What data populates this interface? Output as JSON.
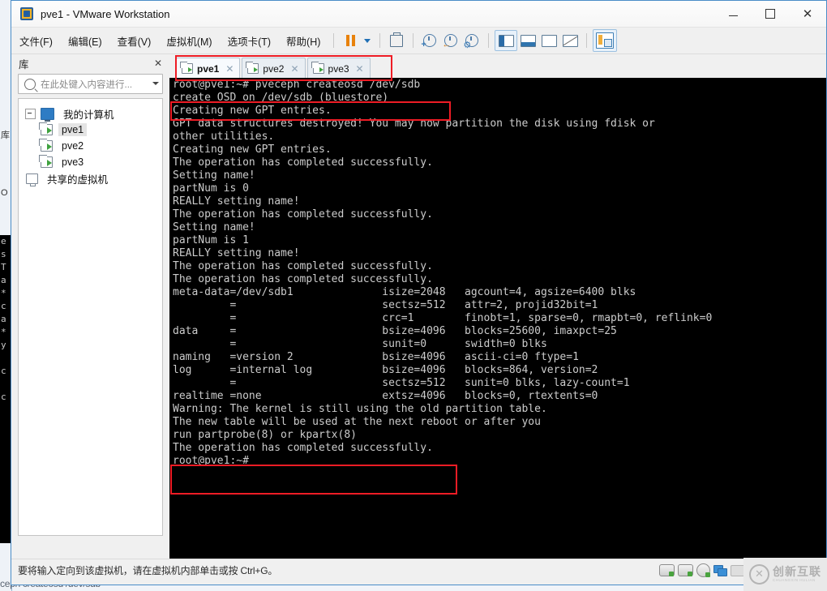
{
  "window": {
    "title": "pve1 - VMware Workstation",
    "app_icon": "vmware-icon",
    "controls": {
      "minimize": "—",
      "maximize": "□",
      "close": "✕"
    }
  },
  "menubar": {
    "items": [
      {
        "label": "文件(F)",
        "name": "menu-file"
      },
      {
        "label": "编辑(E)",
        "name": "menu-edit"
      },
      {
        "label": "查看(V)",
        "name": "menu-view"
      },
      {
        "label": "虚拟机(M)",
        "name": "menu-vm"
      },
      {
        "label": "选项卡(T)",
        "name": "menu-tabs"
      },
      {
        "label": "帮助(H)",
        "name": "menu-help"
      }
    ]
  },
  "toolbar": {
    "icons": [
      "pause-icon",
      "power-dropdown-caret-icon",
      "snapshot-icon",
      "take-snapshot-icon",
      "revert-snapshot-icon",
      "snapshot-manager-icon",
      "show-library-icon",
      "show-thumbnail-bar-icon",
      "enter-fullscreen-icon",
      "unity-mode-icon",
      "show-console-panel-icon"
    ],
    "snapshot_badge_add": "+",
    "snapshot_badge_revert": "←",
    "snapshot_badge_manage": "⚙"
  },
  "sidebar": {
    "title": "库",
    "close_label": "✕",
    "search": {
      "placeholder": "在此处键入内容进行...",
      "value": ""
    },
    "tree": [
      {
        "label": "我的计算机",
        "level": 0,
        "icon": "my-computer-icon",
        "selected": false,
        "name": "tree-item-my-computer"
      },
      {
        "label": "pve1",
        "level": 1,
        "icon": "vm-icon",
        "selected": true,
        "name": "tree-item-pve1"
      },
      {
        "label": "pve2",
        "level": 1,
        "icon": "vm-icon",
        "selected": false,
        "name": "tree-item-pve2"
      },
      {
        "label": "pve3",
        "level": 1,
        "icon": "vm-icon",
        "selected": false,
        "name": "tree-item-pve3"
      },
      {
        "label": "共享的虚拟机",
        "level": 0,
        "icon": "shared-vms-icon",
        "selected": false,
        "name": "tree-item-shared-vms"
      }
    ]
  },
  "tabs": [
    {
      "label": "pve1",
      "active": true,
      "close": "✕",
      "name": "tab-pve1"
    },
    {
      "label": "pve2",
      "active": false,
      "close": "✕",
      "name": "tab-pve2"
    },
    {
      "label": "pve3",
      "active": false,
      "close": "✕",
      "name": "tab-pve3"
    }
  ],
  "terminal": {
    "prompt": "root@pve1:~#",
    "command": "pveceph createosd /dev/sdb",
    "lines": [
      "root@pve1:~# pveceph createosd /dev/sdb",
      "create OSD on /dev/sdb (bluestore)",
      "Creating new GPT entries.",
      "GPT data structures destroyed! You may now partition the disk using fdisk or",
      "other utilities.",
      "Creating new GPT entries.",
      "The operation has completed successfully.",
      "Setting name!",
      "partNum is 0",
      "REALLY setting name!",
      "The operation has completed successfully.",
      "Setting name!",
      "partNum is 1",
      "REALLY setting name!",
      "The operation has completed successfully.",
      "The operation has completed successfully.",
      "meta-data=/dev/sdb1              isize=2048   agcount=4, agsize=6400 blks",
      "         =                       sectsz=512   attr=2, projid32bit=1",
      "         =                       crc=1        finobt=1, sparse=0, rmapbt=0, reflink=0",
      "data     =                       bsize=4096   blocks=25600, imaxpct=25",
      "         =                       sunit=0      swidth=0 blks",
      "naming   =version 2              bsize=4096   ascii-ci=0 ftype=1",
      "log      =internal log           bsize=4096   blocks=864, version=2",
      "         =                       sectsz=512   sunit=0 blks, lazy-count=1",
      "realtime =none                   extsz=4096   blocks=0, rtextents=0",
      "Warning: The kernel is still using the old partition table.",
      "The new table will be used at the next reboot or after you",
      "run partprobe(8) or kpartx(8)",
      "The operation has completed successfully.",
      "root@pve1:~#"
    ],
    "highlight_color": "#ee1c25",
    "background": "#000000",
    "foreground": "#cccccc"
  },
  "statusbar": {
    "text": "要将输入定向到该虚拟机，请在虚拟机内部单击或按 Ctrl+G。",
    "devices": [
      "hard-disk-icon",
      "hard-disk-icon",
      "cd-dvd-icon",
      "network-adapter-icon",
      "printer-icon"
    ]
  },
  "watermark": {
    "logo": "✕",
    "cn": "创新互联",
    "en": "CHUANGXIN HULIAN"
  },
  "background_window": {
    "left_strip_chars": [
      "e",
      "s",
      "T",
      "a",
      "·",
      "c",
      "a",
      "·",
      "y",
      "",
      "c",
      "",
      "c",
      ""
    ],
    "lib_char": "库",
    "o_char": "O",
    "bottom_text": "ceph createosd /dev/sdb"
  }
}
